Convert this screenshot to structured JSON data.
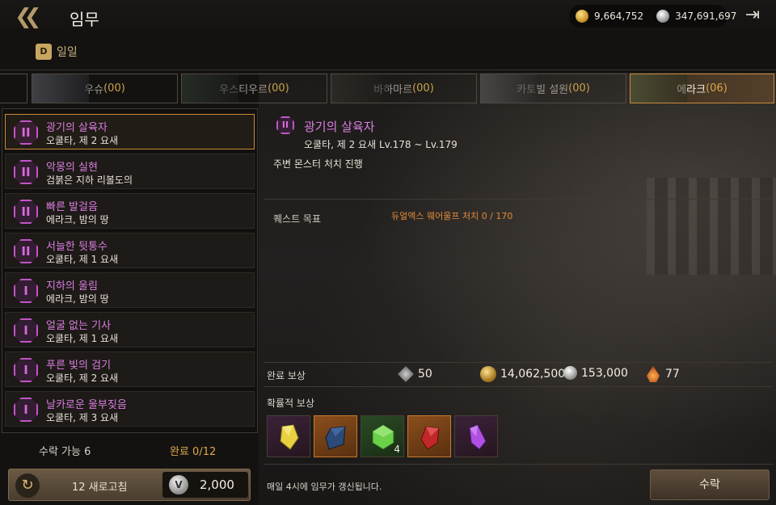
{
  "header": {
    "title": "임무",
    "gold": "9,664,752",
    "silver": "347,691,697"
  },
  "daily_tab": {
    "icon_letter": "D",
    "label": "일일"
  },
  "region_tabs": [
    {
      "name": "우슈",
      "count": "(00)"
    },
    {
      "name": "우스티우르",
      "count": "(00)"
    },
    {
      "name": "바하마르",
      "count": "(00)"
    },
    {
      "name": "카토빌 설원",
      "count": "(00)"
    },
    {
      "name": "에라크",
      "count": "(06)"
    }
  ],
  "quests": [
    {
      "grade": "II",
      "name": "광기의 살육자",
      "location": "오쿨타, 제 2 요새"
    },
    {
      "grade": "II",
      "name": "악몽의 실현",
      "location": "검붉은 지하 리볼도의"
    },
    {
      "grade": "II",
      "name": "빠른 발걸음",
      "location": "에라크, 밤의 땅"
    },
    {
      "grade": "II",
      "name": "서늘한 뒷통수",
      "location": "오쿨타, 제 1 요새"
    },
    {
      "grade": "I",
      "name": "지하의 울림",
      "location": "에라크, 밤의 땅"
    },
    {
      "grade": "I",
      "name": "얼굴 없는 기사",
      "location": "오쿨타, 제 1 요새"
    },
    {
      "grade": "I",
      "name": "푸른 빛의 검기",
      "location": "오쿨타, 제 2 요새"
    },
    {
      "grade": "I",
      "name": "날카로운 울부짖음",
      "location": "오쿨타, 제 3 요새"
    }
  ],
  "footer": {
    "accept_count": "수락 가능 6",
    "complete_count": "완료 0/12",
    "refresh_label": "12 새로고침",
    "refresh_coin": "V",
    "refresh_cost": "2,000"
  },
  "detail": {
    "grade": "II",
    "title": "광기의 살육자",
    "location": "오쿨타, 제 2 요새 Lv.178 ~ Lv.179",
    "description": "주변 몬스터 처치 진행",
    "objective_label": "퀘스트 목표",
    "objective_text": "듀얼엑스 웨어울프 처치 0 / 170",
    "reward_label": "완료 보상",
    "rewards": {
      "exp": "50",
      "gold": "14,062,500",
      "silver": "153,000",
      "points": "77"
    },
    "prob_label": "확률적 보상",
    "prob_items": [
      {
        "gem": "yellow-crystal-icon",
        "color": "#e8d040",
        "bg": "purple",
        "qty": ""
      },
      {
        "gem": "dark-blue-crystal-icon",
        "color": "#2c4a78",
        "bg": "orange",
        "qty": ""
      },
      {
        "gem": "green-gem-icon",
        "color": "#6ad04a",
        "bg": "green",
        "qty": "4"
      },
      {
        "gem": "red-crystal-icon",
        "color": "#c02828",
        "bg": "orange",
        "qty": ""
      },
      {
        "gem": "purple-crystal-icon",
        "color": "#b050e0",
        "bg": "purple",
        "qty": ""
      }
    ],
    "notice": "매일 4시에 임무가 갱신됩니다.",
    "accept_button": "수락"
  }
}
